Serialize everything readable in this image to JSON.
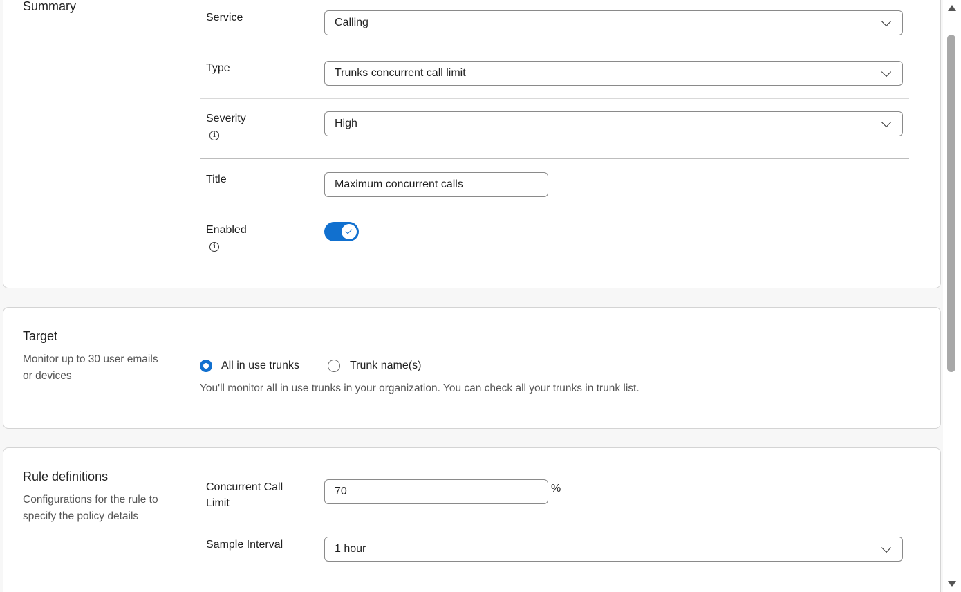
{
  "summary": {
    "title": "Summary",
    "service": {
      "label": "Service",
      "value": "Calling"
    },
    "type": {
      "label": "Type",
      "value": "Trunks concurrent call limit"
    },
    "severity": {
      "label": "Severity",
      "value": "High"
    },
    "title_field": {
      "label": "Title",
      "value": "Maximum concurrent calls"
    },
    "enabled": {
      "label": "Enabled",
      "on": true
    }
  },
  "target": {
    "title": "Target",
    "description": "Monitor up to 30 user emails or devices",
    "options": [
      {
        "label": "All in use trunks",
        "selected": true
      },
      {
        "label": "Trunk name(s)",
        "selected": false
      }
    ],
    "help": "You'll monitor all in use trunks in your organization. You can check all your trunks in trunk list."
  },
  "rules": {
    "title": "Rule definitions",
    "description": "Configurations for the rule to specify the policy details",
    "concurrent_limit": {
      "label": "Concurrent Call Limit",
      "value": "70",
      "unit": "%"
    },
    "sample_interval": {
      "label": "Sample Interval",
      "value": "1 hour"
    }
  },
  "icons": {
    "info": "info-icon",
    "chevron": "chevron-down-icon",
    "check": "check-icon"
  },
  "colors": {
    "accent": "#1170cf",
    "border": "#8a8a8a",
    "background": "#f7f7f7"
  }
}
